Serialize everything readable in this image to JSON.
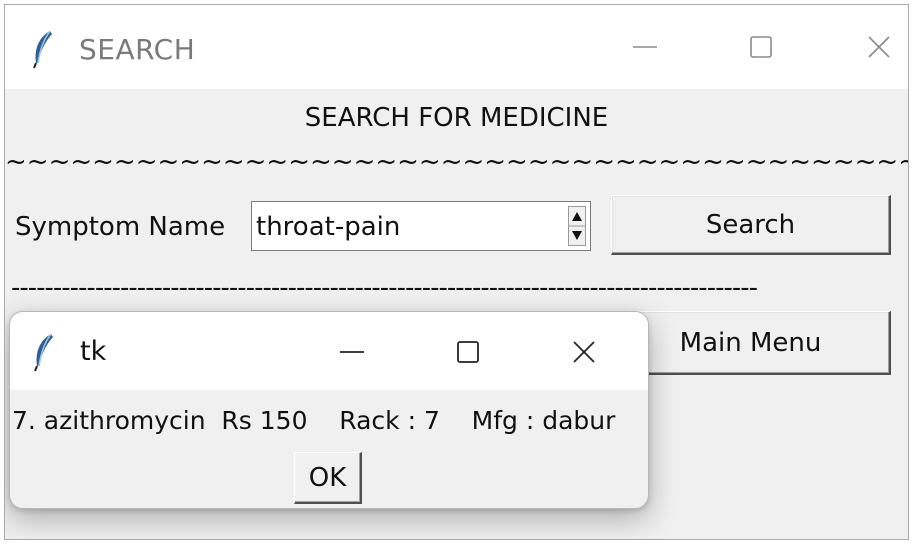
{
  "main_window": {
    "title": "SEARCH",
    "heading": "SEARCH FOR MEDICINE",
    "tilde_separator": "~~~~~~~~~~~~~~~~~~~~~~~~~~~~~~~~~~~~~~~~~~",
    "symptom_label": "Symptom Name",
    "symptom_value": "throat-pain",
    "search_label": "Search",
    "dash_separator": "-----------------------------------------------------------------------------------------",
    "main_menu_label": "Main Menu",
    "icon": "feather-icon"
  },
  "popup": {
    "title": "tk",
    "message": "7. azithromycin  Rs 150    Rack : 7    Mfg : dabur",
    "ok_label": "OK",
    "icon": "feather-icon"
  },
  "colors": {
    "window_bg": "#f0f0f0",
    "titlebar_bg": "#ffffff",
    "feather_blue": "#3a6ea5"
  }
}
